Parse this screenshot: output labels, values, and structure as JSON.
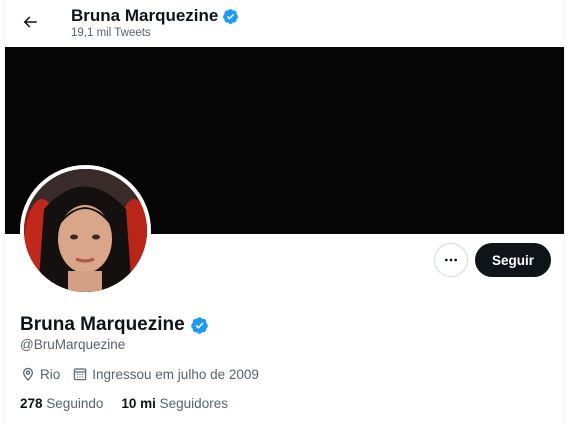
{
  "header": {
    "name": "Bruna Marquezine",
    "tweet_count": "19,1 mil Tweets"
  },
  "profile": {
    "name": "Bruna Marquezine",
    "handle": "@BruMarquezine",
    "location": "Rio",
    "joined": "Ingressou em julho de 2009",
    "following_count": "278",
    "following_label": "Seguindo",
    "followers_count": "10 mi",
    "followers_label": "Seguidores"
  },
  "actions": {
    "follow_label": "Seguir",
    "more_icon": "more-icon"
  },
  "icons": {
    "back": "arrow-left-icon",
    "verified": "verified-badge-icon",
    "location": "location-pin-icon",
    "calendar": "calendar-icon"
  },
  "colors": {
    "verified": "#1d9bf0",
    "banner": "#050505",
    "follow_button": "#0f1419",
    "secondary_text": "#536471"
  }
}
